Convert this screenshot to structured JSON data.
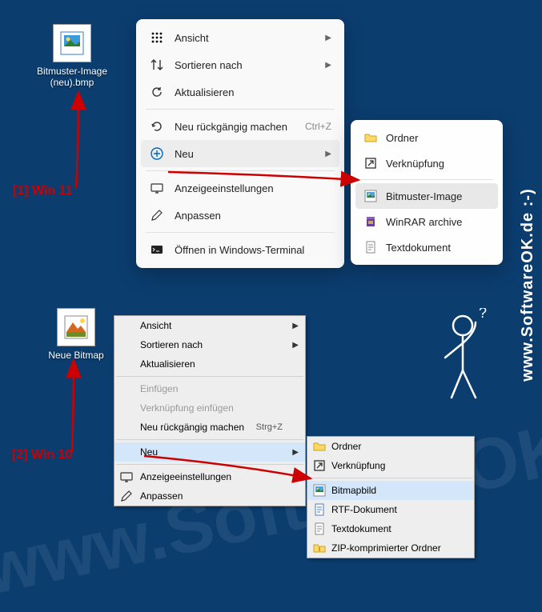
{
  "watermark": "www.SoftwareOK.de :-)",
  "annotations": {
    "win11": "[1] Win 11",
    "win10": "[2] Win 10"
  },
  "icons": {
    "bmp_new": {
      "label": "Bitmuster-Image\n(neu).bmp"
    },
    "bmp_neue": {
      "label": "Neue Bitmap"
    }
  },
  "menu11": {
    "items": [
      {
        "icon": "grid-icon",
        "label": "Ansicht",
        "arrow": true
      },
      {
        "icon": "sort-icon",
        "label": "Sortieren nach",
        "arrow": true
      },
      {
        "icon": "refresh-icon",
        "label": "Aktualisieren"
      },
      {
        "sep": true
      },
      {
        "icon": "undo-icon",
        "label": "Neu rückgängig machen",
        "shortcut": "Ctrl+Z"
      },
      {
        "icon": "plus-circle-icon",
        "label": "Neu",
        "arrow": true,
        "hover": true
      },
      {
        "sep": true
      },
      {
        "icon": "display-icon",
        "label": "Anzeigeeinstellungen"
      },
      {
        "icon": "personalize-icon",
        "label": "Anpassen"
      },
      {
        "sep": true
      },
      {
        "icon": "terminal-icon",
        "label": "Öffnen in Windows-Terminal"
      }
    ]
  },
  "submenu11": {
    "items": [
      {
        "icon": "folder-icon",
        "label": "Ordner"
      },
      {
        "icon": "shortcut-icon",
        "label": "Verknüpfung"
      },
      {
        "sep": true
      },
      {
        "icon": "bitmap-icon",
        "label": "Bitmuster-Image",
        "hover": true
      },
      {
        "icon": "winrar-icon",
        "label": "WinRAR archive"
      },
      {
        "icon": "text-icon",
        "label": "Textdokument"
      }
    ]
  },
  "menu10": {
    "items": [
      {
        "label": "Ansicht",
        "arrow": true
      },
      {
        "label": "Sortieren nach",
        "arrow": true
      },
      {
        "label": "Aktualisieren"
      },
      {
        "sep": true
      },
      {
        "label": "Einfügen",
        "disabled": true
      },
      {
        "label": "Verknüpfung einfügen",
        "disabled": true
      },
      {
        "label": "Neu rückgängig machen",
        "shortcut": "Strg+Z"
      },
      {
        "sep": true
      },
      {
        "label": "Neu",
        "arrow": true,
        "hover": true
      },
      {
        "sep": true
      },
      {
        "icon": "display-icon",
        "label": "Anzeigeeinstellungen"
      },
      {
        "icon": "personalize-icon",
        "label": "Anpassen"
      }
    ]
  },
  "submenu10": {
    "items": [
      {
        "icon": "folder-icon",
        "label": "Ordner"
      },
      {
        "icon": "shortcut-icon",
        "label": "Verknüpfung"
      },
      {
        "sep": true
      },
      {
        "icon": "bitmap-icon",
        "label": "Bitmapbild",
        "hover": true
      },
      {
        "icon": "rtf-icon",
        "label": "RTF-Dokument"
      },
      {
        "icon": "text-icon",
        "label": "Textdokument"
      },
      {
        "icon": "zip-icon",
        "label": "ZIP-komprimierter Ordner"
      }
    ]
  }
}
